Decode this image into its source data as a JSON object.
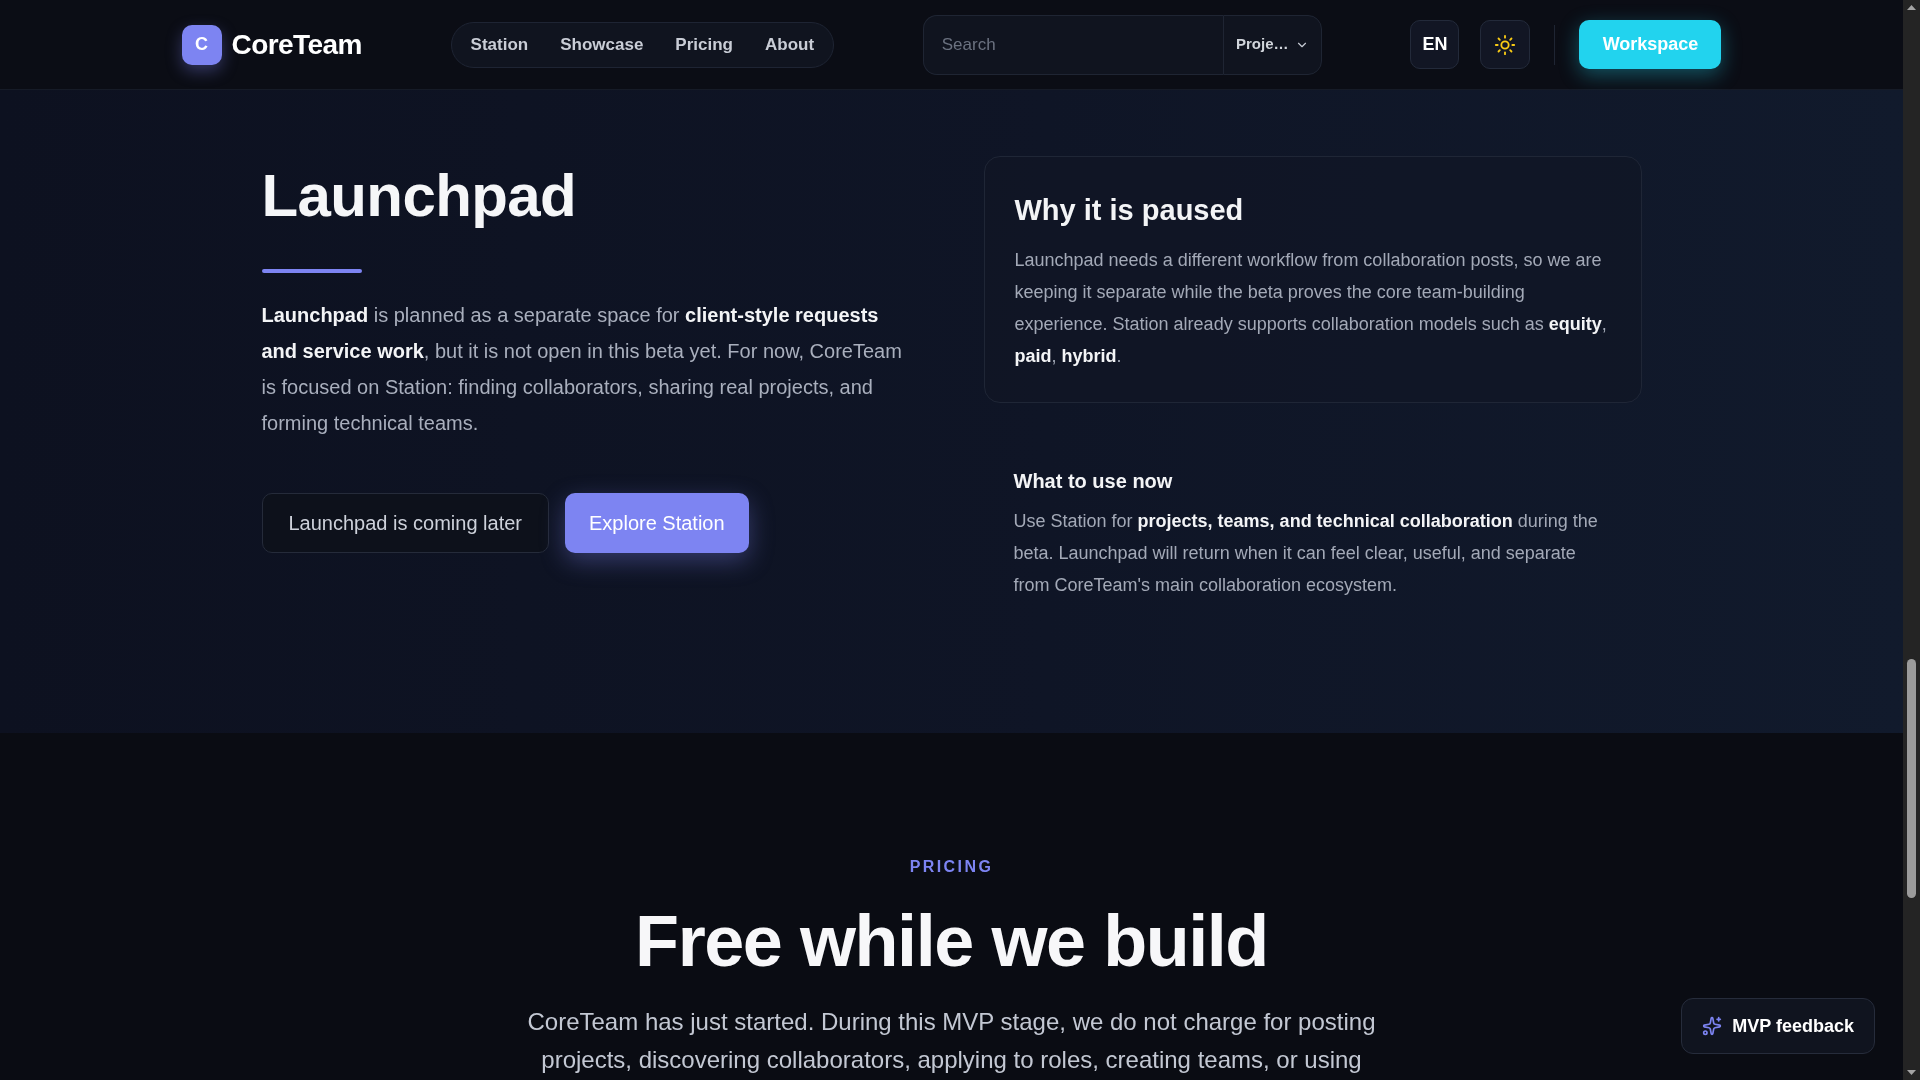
{
  "header": {
    "logo": {
      "mark": "C",
      "name": "CoreTeam"
    },
    "nav": [
      "Station",
      "Showcase",
      "Pricing",
      "About"
    ],
    "search": {
      "placeholder": "Search",
      "scope": "Proje…"
    },
    "language": "EN",
    "workspace_button": "Workspace"
  },
  "launchpad": {
    "title": "Launchpad",
    "description": "**Launchpad** is planned as a separate space for **client-style requests and service work**, but it is not open in this beta yet. For now, CoreTeam is focused on Station: finding collaborators, sharing real projects, and forming technical teams.",
    "buttons": [
      {
        "label": "Launchpad is coming later",
        "kind": "secondary"
      },
      {
        "label": "Explore Station",
        "kind": "primary"
      }
    ],
    "paused_card": {
      "title": "Why it is paused",
      "text": "Launchpad needs a different workflow from collaboration posts, so we are keeping it separate while the beta proves the core team-building experience. Station already supports collaboration models such as **equity**, **paid**, **hybrid**."
    },
    "use_now": {
      "title": "What to use now",
      "text": "Use Station for **projects, teams, and technical collaboration** during the beta. Launchpad will return when it can feel clear, useful, and separate from CoreTeam's main collaboration ecosystem."
    }
  },
  "pricing": {
    "eyebrow": "PRICING",
    "title": "Free while we build",
    "text": "CoreTeam has just started. During this MVP stage, we do not charge for posting projects, discovering collaborators, applying to roles, creating teams, or using"
  },
  "feedback_button": "MVP feedback"
}
